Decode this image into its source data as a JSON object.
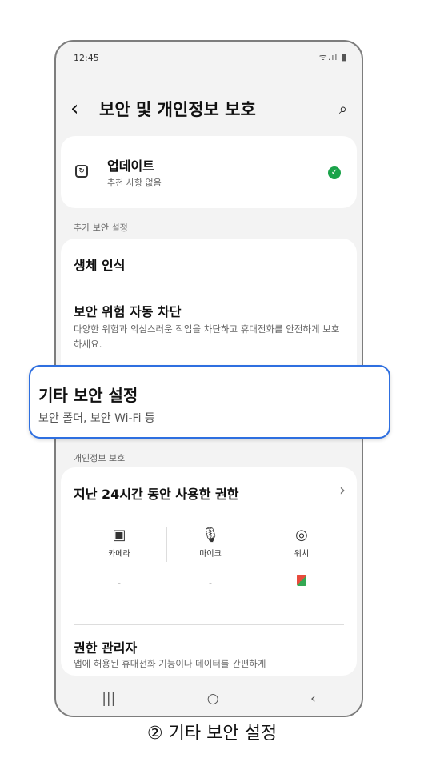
{
  "status": {
    "time": "12:45",
    "icons": "ᯤ.ıl ▮"
  },
  "header": {
    "back": "‹",
    "title": "보안 및 개인정보 보호",
    "search": "⌕"
  },
  "update": {
    "title": "업데이트",
    "subtitle": "추천 사항 없음",
    "status": "✓"
  },
  "section_extra": "추가 보안 설정",
  "biometrics": "생체 인식",
  "auto_block": {
    "title": "보안 위험 자동 차단",
    "subtitle": "다양한 위험과 의심스러운 작업을 차단하고 휴대전화를 안전하게 보호하세요."
  },
  "other_security": {
    "title": "기타 보안 설정",
    "subtitle": "보안 폴더, 보안 Wi-Fi 등"
  },
  "section_privacy": "개인정보 보호",
  "permissions": {
    "title": "지난 24시간 동안 사용한 권한",
    "chevron": "›",
    "items": [
      {
        "label": "카메라",
        "icon": "▣",
        "value": "-"
      },
      {
        "label": "마이크",
        "icon": "🎙",
        "value": "-"
      },
      {
        "label": "위치",
        "icon": "◎",
        "value": ""
      }
    ]
  },
  "permission_manager": {
    "title": "권한 관리자",
    "subtitle": "앱에 허용된 휴대전화 기능이나 데이터를 간편하게"
  },
  "navbar": {
    "recent": "|||",
    "home": "○",
    "back": "‹"
  },
  "caption": "② 기타 보안 설정",
  "colors": {
    "accent": "#2e6fe0",
    "ok": "#1aa34a"
  }
}
